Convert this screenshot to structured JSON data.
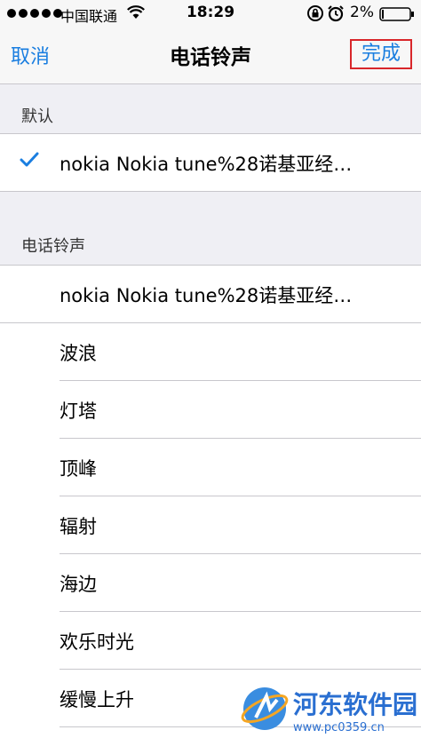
{
  "status_bar": {
    "carrier": "中国联通",
    "time": "18:29",
    "battery_percent": "2%",
    "signal_bars": 5,
    "icons": [
      "signal-dots-icon",
      "wifi-icon",
      "rotation-lock-icon",
      "alarm-icon",
      "battery-icon"
    ]
  },
  "nav": {
    "cancel_label": "取消",
    "title": "电话铃声",
    "done_label": "完成",
    "accent_color": "#1a7ee0",
    "highlight_color": "#d8262a"
  },
  "default_section": {
    "header": "默认",
    "selected_item": "nokia Nokia tune%28诺基亚经…"
  },
  "ringtone_section": {
    "header": "电话铃声",
    "custom_item": "nokia Nokia tune%28诺基亚经…",
    "items": [
      "波浪",
      "灯塔",
      "顶峰",
      "辐射",
      "海边",
      "欢乐时光",
      "缓慢上升"
    ]
  },
  "watermark": {
    "name": "河东软件园",
    "url": "www.pc0359.cn"
  }
}
